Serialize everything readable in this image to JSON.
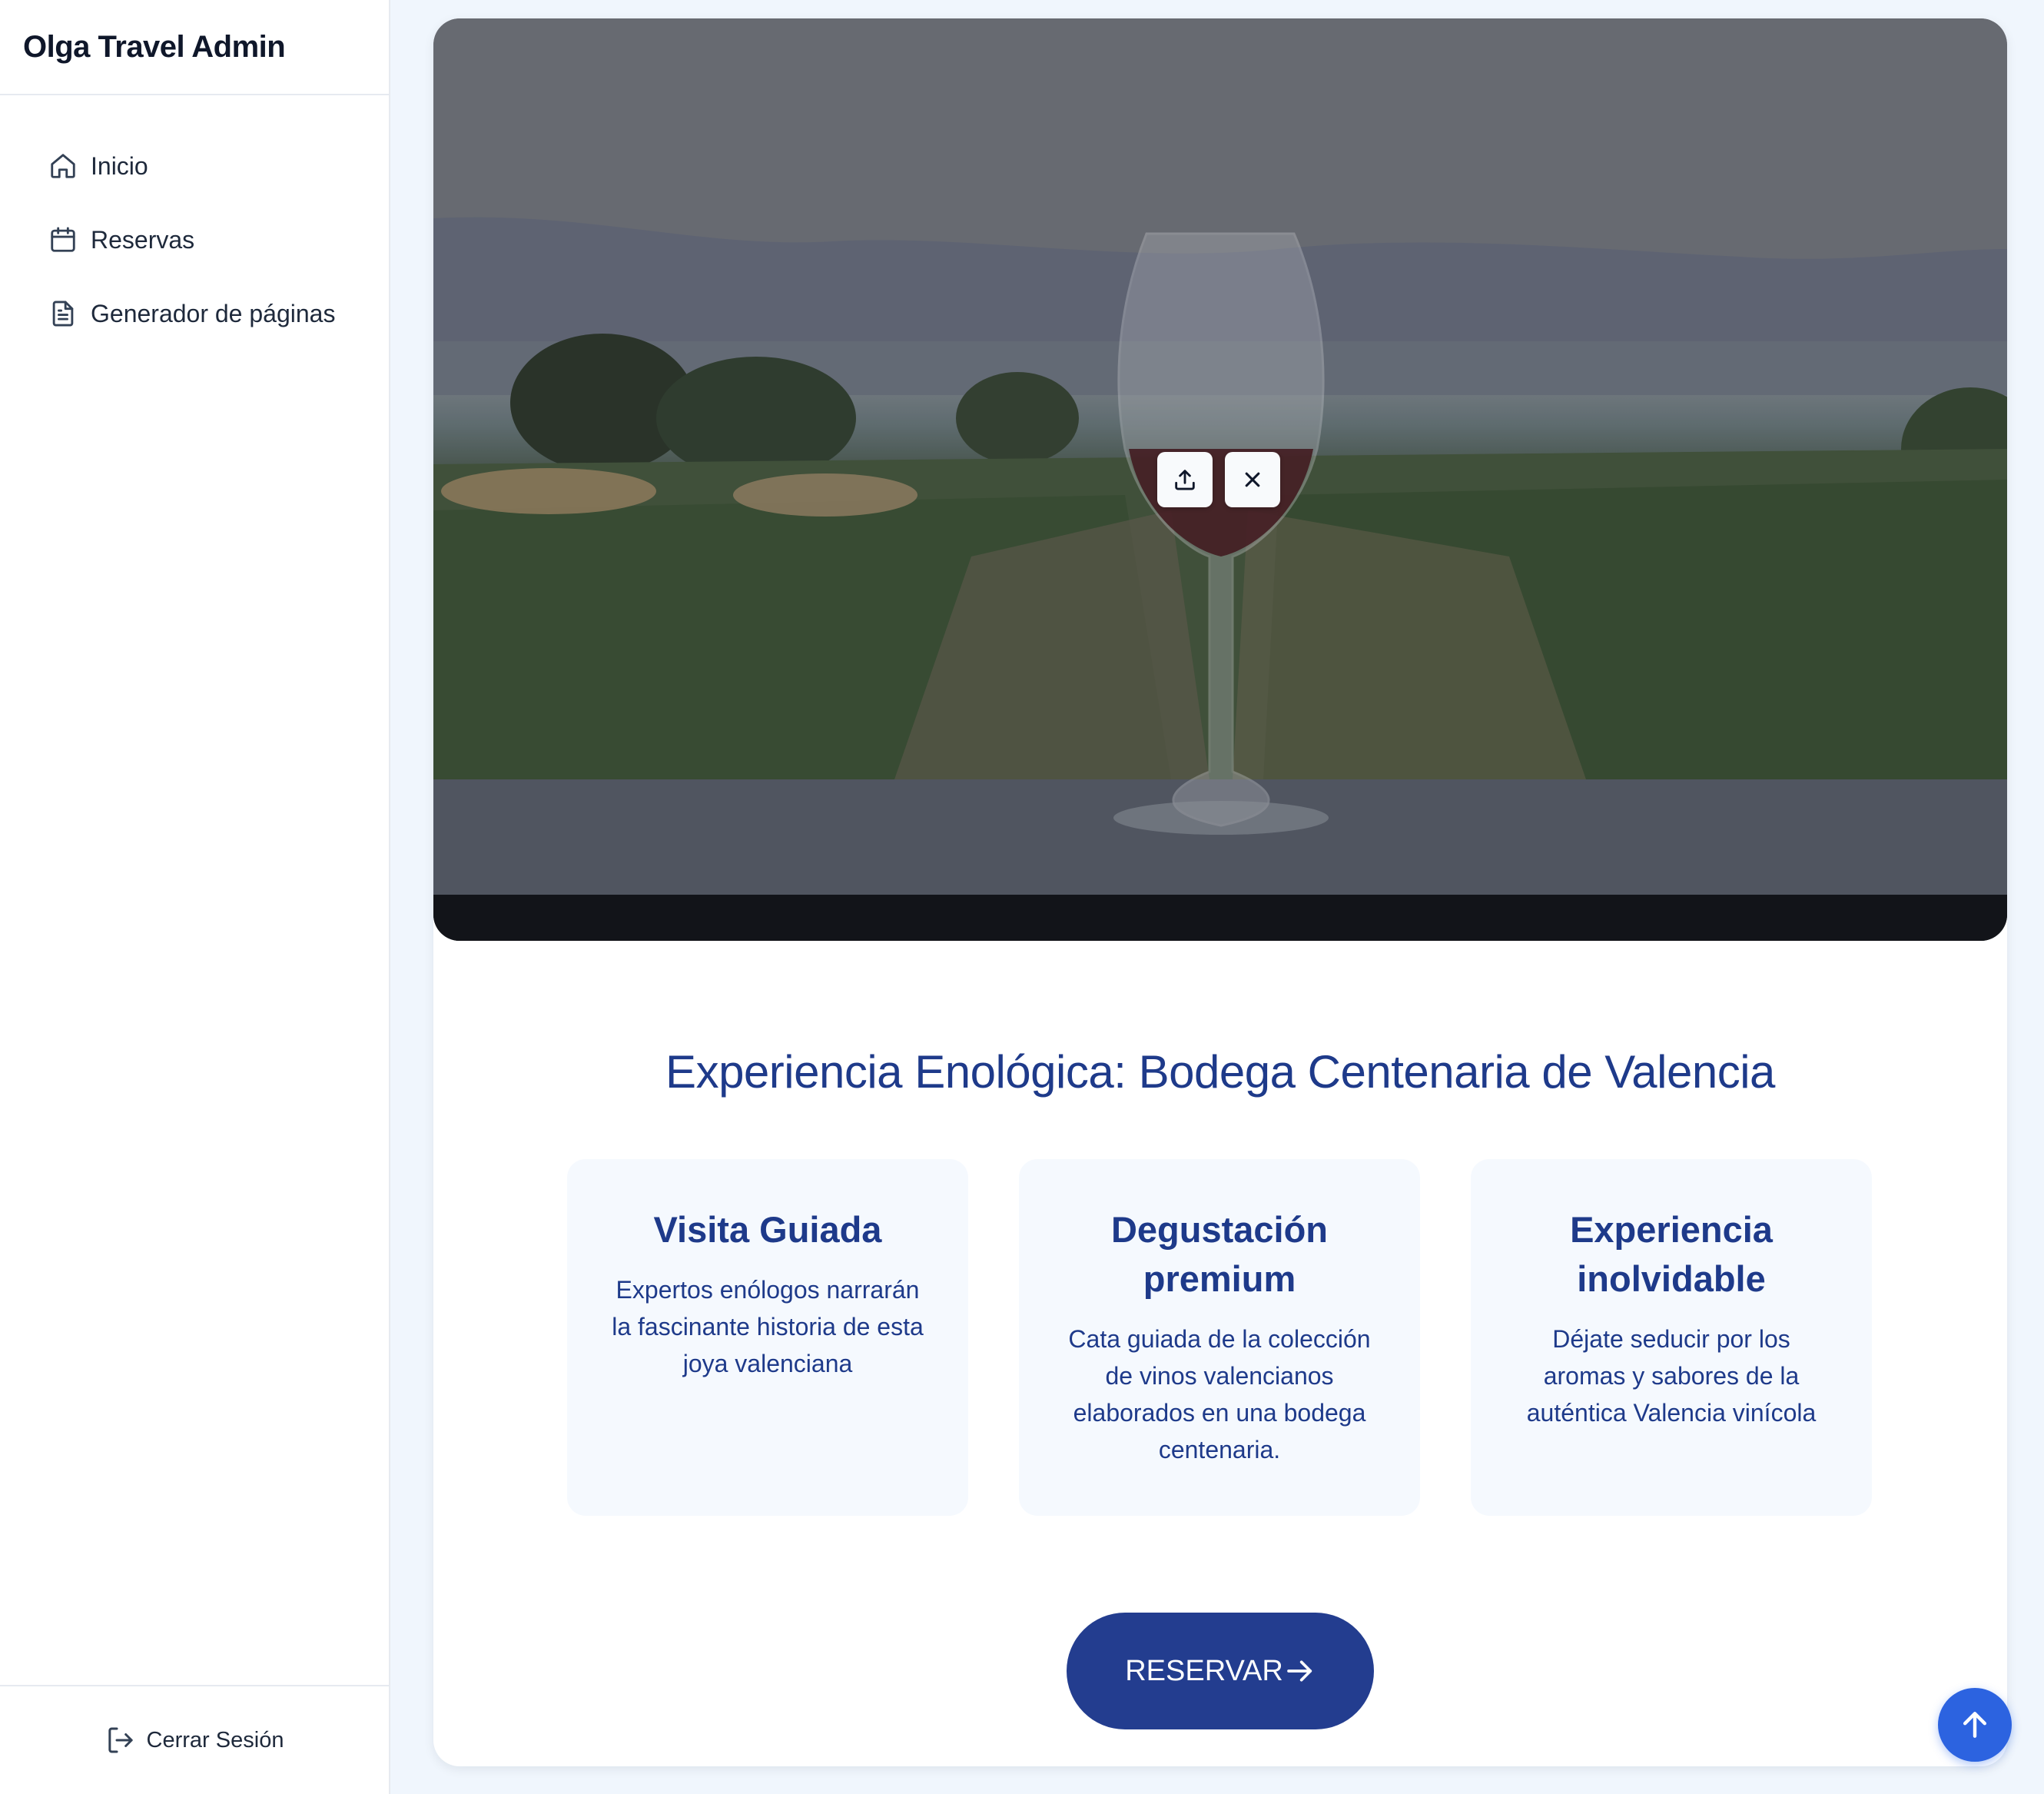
{
  "app": {
    "title": "Olga Travel Admin"
  },
  "sidebar": {
    "items": [
      {
        "label": "Inicio",
        "icon": "home-icon"
      },
      {
        "label": "Reservas",
        "icon": "calendar-icon"
      },
      {
        "label": "Generador de páginas",
        "icon": "file-text-icon"
      }
    ],
    "logout_label": "Cerrar Sesión"
  },
  "hero": {
    "tools": [
      "upload-icon",
      "close-icon"
    ]
  },
  "page": {
    "title": "Experiencia Enológica: Bodega Centenaria de Valencia",
    "features": [
      {
        "title": "Visita Guiada",
        "description": "Expertos enólogos narrarán la fascinante historia de esta joya valenciana"
      },
      {
        "title": "Degustación premium",
        "description": "Cata guiada de la colección de vinos valencianos elaborados en una bodega centenaria."
      },
      {
        "title": "Experiencia inolvidable",
        "description": "Déjate seducir por los aromas y sabores de la auténtica Valencia vinícola"
      }
    ],
    "cta_label": "RESERVAR"
  },
  "colors": {
    "primary": "#1e3a8a",
    "button": "#233d8f",
    "scroll_button": "#2c63e0",
    "page_bg": "#f0f6fd",
    "card_bg": "#f5f9fe"
  }
}
